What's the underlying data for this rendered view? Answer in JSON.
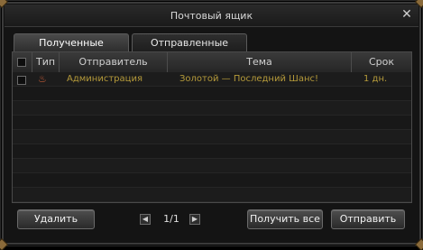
{
  "window": {
    "title": "Почтовый ящик",
    "close_glyph": "✕"
  },
  "tabs": [
    {
      "label": "Полученные",
      "active": true
    },
    {
      "label": "Отправленные",
      "active": false
    }
  ],
  "table": {
    "columns": [
      "Тип",
      "Отправитель",
      "Тема",
      "Срок"
    ],
    "rows": [
      {
        "type_icon": "fire-icon",
        "type_glyph": "♨",
        "sender": "Администрация",
        "subject": "Золотой — Последний Шанс!",
        "term": "1 дн."
      }
    ]
  },
  "buttons": {
    "delete": "Удалить",
    "receive_all": "Получить все",
    "send": "Отправить"
  },
  "pager": {
    "text": "1/1",
    "prev_glyph": "◀",
    "next_glyph": "▶"
  },
  "colors": {
    "accent_gold": "#b59a3a",
    "border": "#4a4a4a"
  }
}
